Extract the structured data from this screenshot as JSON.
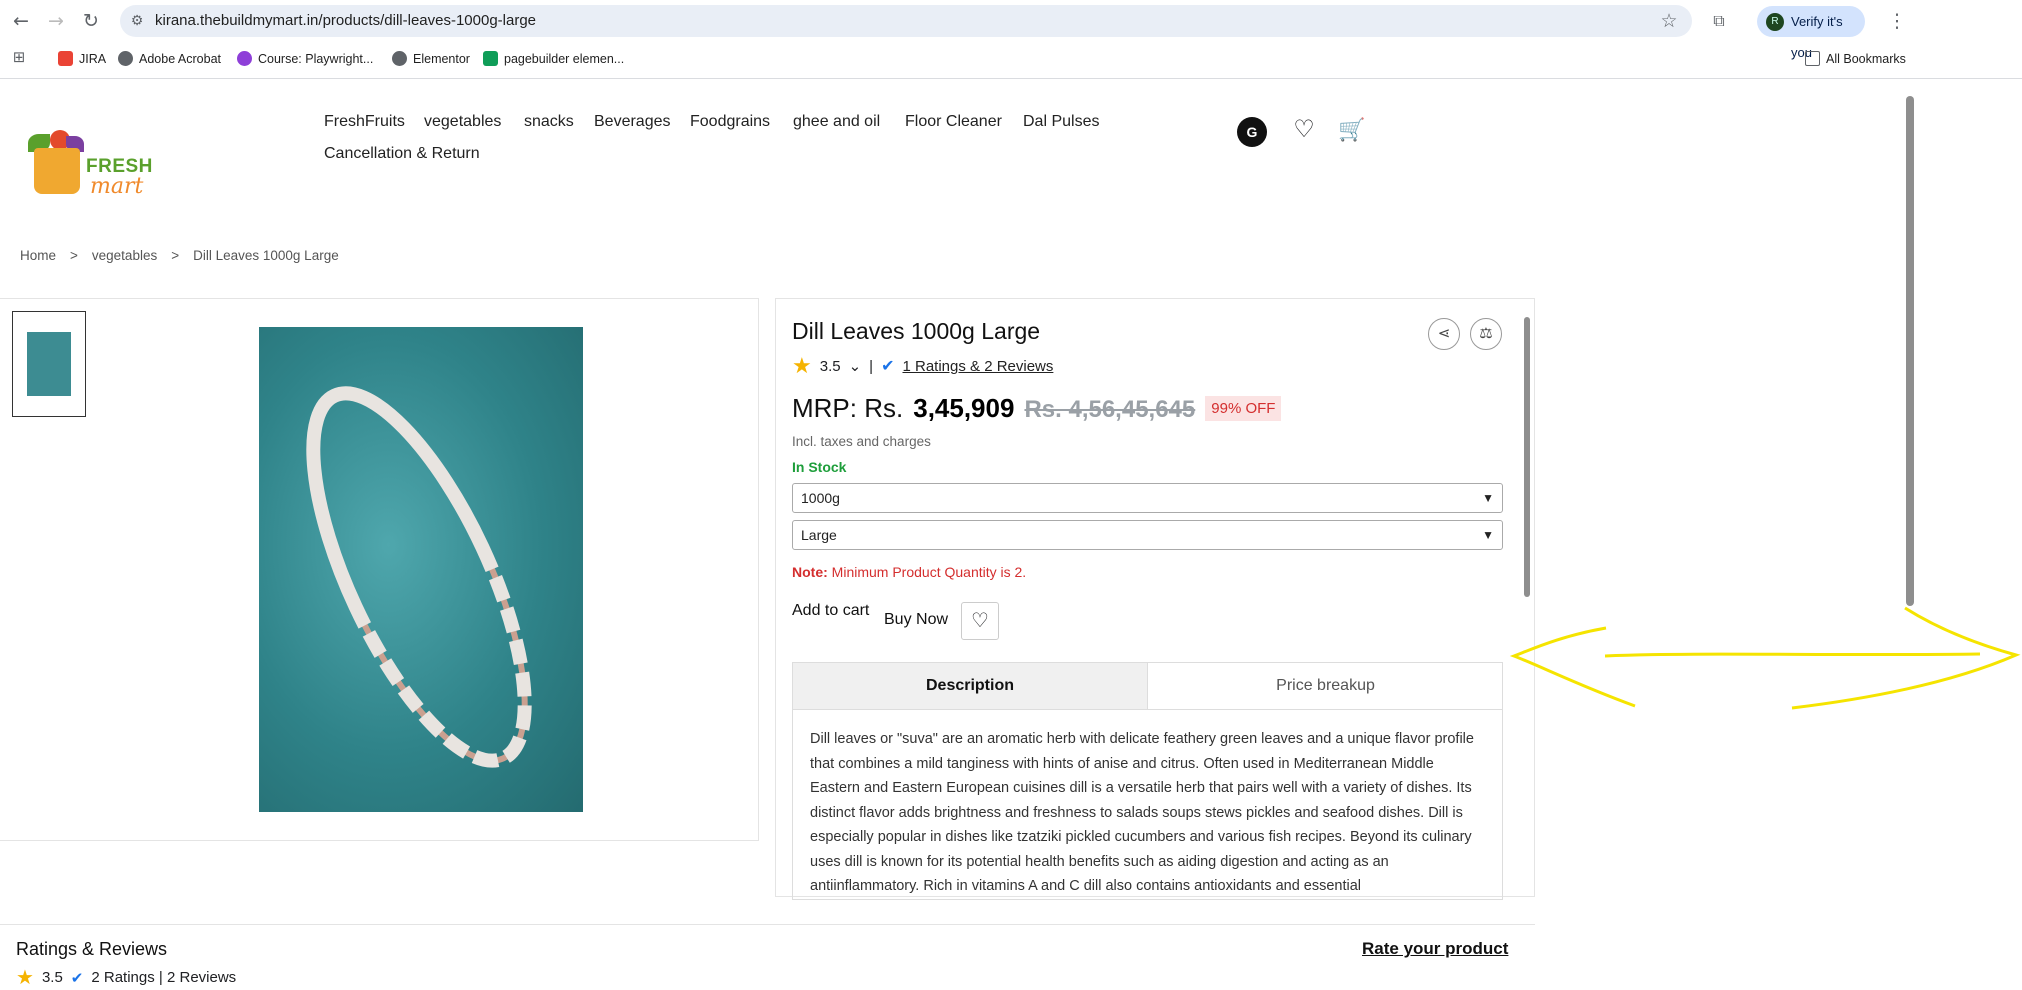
{
  "browser": {
    "url": "kirana.thebuildmymart.in/products/dill-leaves-1000g-large",
    "bookmarks": [
      "JIRA",
      "Adobe Acrobat",
      "Course: Playwright...",
      "Elementor",
      "pagebuilder elemen..."
    ],
    "all_bookmarks": "All Bookmarks",
    "profile_label": "Verify it's you",
    "profile_initial": "R"
  },
  "header": {
    "logo_line1": "FRESH",
    "logo_line2": "mart",
    "menu": [
      "FreshFruits",
      "vegetables",
      "snacks",
      "Beverages",
      "Foodgrains",
      "ghee and oil",
      "Floor Cleaner",
      "Dal Pulses",
      "Cancellation & Return"
    ],
    "user_initial": "G"
  },
  "breadcrumb": [
    "Home",
    ">",
    "vegetables",
    ">",
    "Dill Leaves 1000g Large"
  ],
  "product": {
    "title": "Dill Leaves 1000g Large",
    "rating": "3.5",
    "rating_link": "1 Ratings  & 2 Reviews",
    "mrp_label": "MRP: Rs.",
    "price": "3,45,909",
    "old_price": "Rs. 4,56,45,645",
    "discount": "99% OFF",
    "tax_note": "Incl. taxes and charges",
    "stock": "In Stock",
    "weight_selected": "1000g",
    "size_selected": "Large",
    "note_label": "Note:",
    "note_text": " Minimum Product Quantity is 2.",
    "add_to_cart": "Add to cart",
    "buy_now": "Buy Now",
    "tabs": [
      "Description",
      "Price breakup"
    ],
    "description": "Dill leaves or \"suva\" are an aromatic herb with delicate feathery green leaves and a unique flavor profile that combines a mild tanginess with hints of anise and citrus. Often used in Mediterranean Middle Eastern and Eastern European cuisines dill is a versatile herb that pairs well with a variety of dishes. Its distinct flavor adds brightness and freshness to salads soups stews pickles and seafood dishes. Dill is especially popular in dishes like tzatziki pickled cucumbers and various fish recipes. Beyond its culinary uses dill is known for its potential health benefits such as aiding digestion and acting as an antiinflammatory. Rich in vitamins A and C dill also contains antioxidants and essential"
  },
  "reviews": {
    "title": "Ratings & Reviews",
    "rating": "3.5",
    "summary": "2 Ratings | 2 Reviews",
    "rate_link": "Rate your product"
  },
  "colors": {
    "accent_green": "#1e9e3b",
    "discount_red": "#d42e2e",
    "annotation": "#f5e400"
  }
}
